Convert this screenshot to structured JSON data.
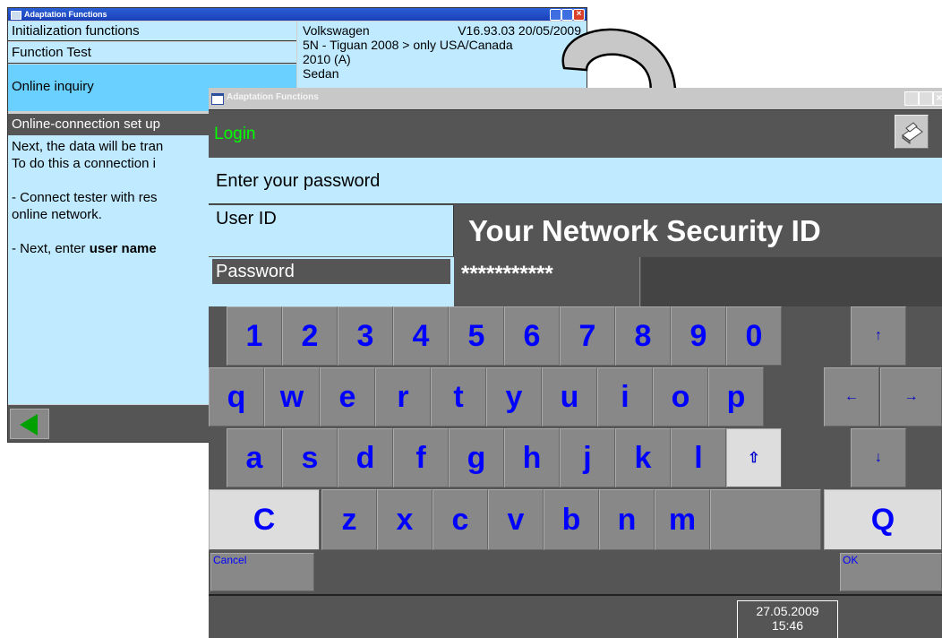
{
  "back_window": {
    "title": "Adaptation Functions",
    "menu": [
      "Initialization functions",
      "Function Test",
      "Online inquiry"
    ],
    "vehicle": {
      "make": "Volkswagen",
      "version": "V16.93.03 20/05/2009",
      "model": "5N - Tiguan 2008 > only USA/Canada",
      "year": "2010 (A)",
      "body": "Sedan"
    },
    "section_header": "Online-connection set up",
    "text_lines": [
      "Next, the data will be tran",
      "To do this a connection i",
      "",
      "- Connect tester with res",
      "online network.",
      "",
      "- Next, enter "
    ],
    "bold_fragment": "user name",
    "nav_back_icon": "back-arrow-icon"
  },
  "front_window": {
    "title": "Adaptation Functions",
    "header": "Login",
    "header_icon": "print-icon",
    "prompt": "Enter your password",
    "user_id_label": "User ID",
    "user_id_value": "Your Network Security ID",
    "password_label": "Password",
    "password_value": "***********",
    "keys_row1": [
      "1",
      "2",
      "3",
      "4",
      "5",
      "6",
      "7",
      "8",
      "9",
      "0"
    ],
    "keys_row2": [
      "q",
      "w",
      "e",
      "r",
      "t",
      "y",
      "u",
      "i",
      "o",
      "p"
    ],
    "keys_row3": [
      "a",
      "s",
      "d",
      "f",
      "g",
      "h",
      "j",
      "k",
      "l"
    ],
    "shift_key": "⇧",
    "keys_row4": [
      "z",
      "x",
      "c",
      "v",
      "b",
      "n",
      "m"
    ],
    "clear_key": "C",
    "quit_key": "Q",
    "arrows": {
      "up": "↑",
      "left": "←",
      "right": "→",
      "down": "↓"
    },
    "cancel_label": "Cancel",
    "ok_label": "OK",
    "date": "27.05.2009",
    "time": "15:46"
  },
  "colors": {
    "accent_green": "#00ff00",
    "key_text": "#0000ff",
    "panel": "#bfeaff"
  }
}
